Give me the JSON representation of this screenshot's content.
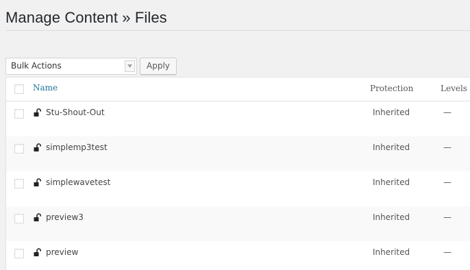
{
  "header": {
    "title": "Manage Content » Files"
  },
  "toolbar": {
    "bulk_actions_value": "Bulk Actions",
    "apply_label": "Apply"
  },
  "table": {
    "columns": {
      "name": "Name",
      "protection": "Protection",
      "levels": "Levels"
    },
    "rows": [
      {
        "name": "Stu-Shout-Out",
        "protection": "Inherited",
        "levels": "—",
        "icon": "unlock-icon"
      },
      {
        "name": "simplemp3test",
        "protection": "Inherited",
        "levels": "—",
        "icon": "unlock-icon"
      },
      {
        "name": "simplewavetest",
        "protection": "Inherited",
        "levels": "—",
        "icon": "unlock-icon"
      },
      {
        "name": "preview3",
        "protection": "Inherited",
        "levels": "—",
        "icon": "unlock-icon"
      },
      {
        "name": "preview",
        "protection": "Inherited",
        "levels": "—",
        "icon": "unlock-icon"
      }
    ]
  },
  "colors": {
    "link": "#21759b",
    "background": "#f1f1f1",
    "row_alt": "#f9f9f9"
  }
}
